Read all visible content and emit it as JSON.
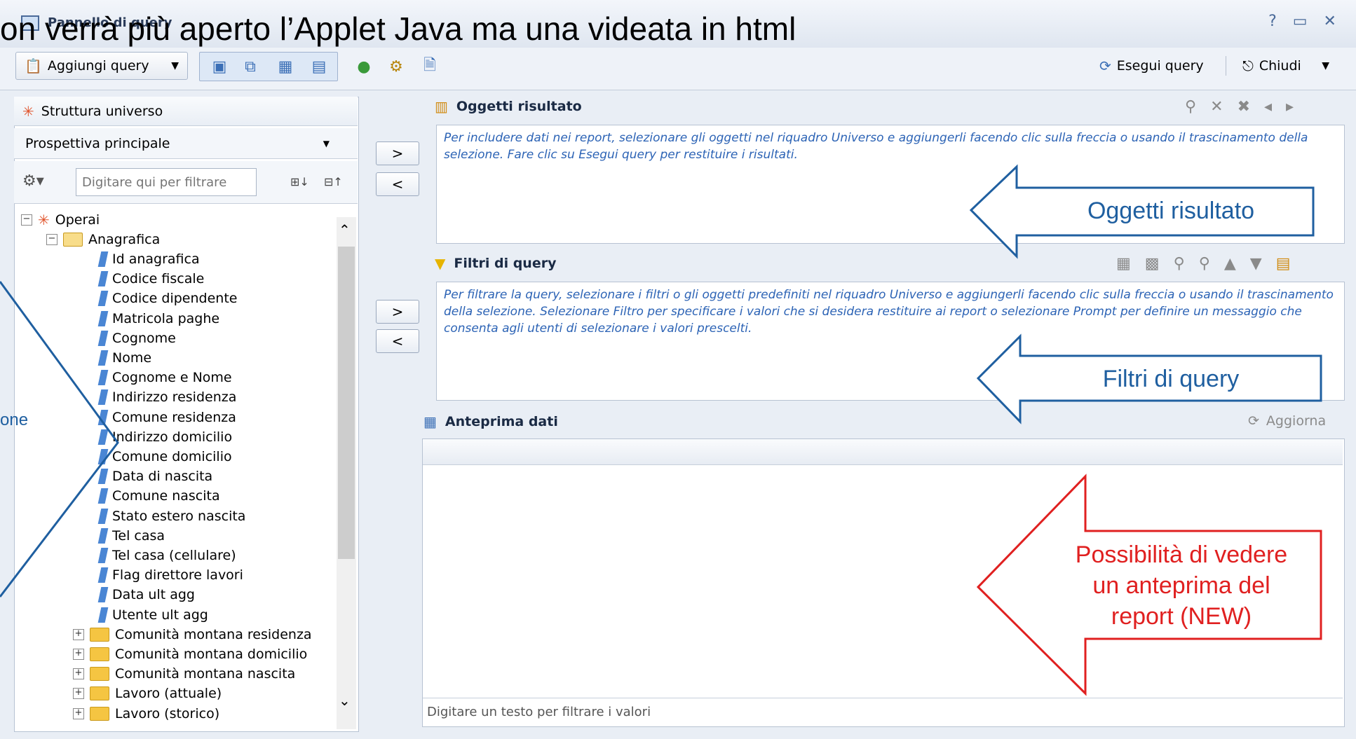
{
  "window": {
    "title": "Pannello di query",
    "slide_caption": "on verrà più aperto l’Applet Java ma una videata in html",
    "controls": "? ▭ ✕"
  },
  "toolbar": {
    "add_query_label": "Aggiungi query",
    "run_query_label": "Esegui query",
    "close_label": "Chiudi"
  },
  "universe": {
    "header": "Struttura universo",
    "perspective": "Prospettiva principale",
    "filter_placeholder": "Digitare qui per filtrare",
    "tree": {
      "root": "Operai",
      "folder": "Anagrafica",
      "leaves": [
        "Id anagrafica",
        "Codice fiscale",
        "Codice dipendente",
        "Matricola paghe",
        "Cognome",
        "Nome",
        "Cognome e Nome",
        "Indirizzo residenza",
        "Comune residenza",
        "Indirizzo domicilio",
        "Comune domicilio",
        "Data di nascita",
        "Comune nascita",
        "Stato estero nascita",
        "Tel casa",
        "Tel casa (cellulare)",
        "Flag direttore lavori",
        "Data ult agg",
        "Utente ult agg"
      ],
      "subfolders": [
        "Comunità montana residenza",
        "Comunità montana domicilio",
        "Comunità montana nascita",
        "Lavoro (attuale)",
        "Lavoro (storico)"
      ]
    }
  },
  "result_objects": {
    "title": "Oggetti risultato",
    "hint": "Per includere dati nei report, selezionare gli oggetti nel riquadro Universo e aggiungerli facendo clic sulla freccia o usando il trascinamento della selezione. Fare clic su Esegui query per restituire i risultati."
  },
  "query_filters": {
    "title": "Filtri di query",
    "hint": "Per filtrare la query, selezionare i filtri o gli oggetti predefiniti nel riquadro Universo e aggiungerli facendo clic sulla freccia o usando il trascinamento della selezione. Selezionare Filtro per specificare i valori che si desidera restituire ai report o selezionare Prompt per definire un messaggio che consenta agli utenti di selezionare i valori prescelti."
  },
  "data_preview": {
    "title": "Anteprima dati",
    "refresh_label": "Aggiorna",
    "filter_placeholder": "Digitare un testo per filtrare i valori"
  },
  "move_buttons": {
    "add": ">",
    "remove": "<"
  },
  "callouts": {
    "result": "Oggetti risultato",
    "filters": "Filtri di query",
    "preview_line1": "Possibilità di vedere",
    "preview_line2": "un anteprima del",
    "preview_line3": "report (NEW)",
    "left_partial": "one"
  },
  "colors": {
    "callout_blue": "#1f5fa0",
    "callout_red": "#e02020",
    "hint_blue": "#2c63b5"
  }
}
